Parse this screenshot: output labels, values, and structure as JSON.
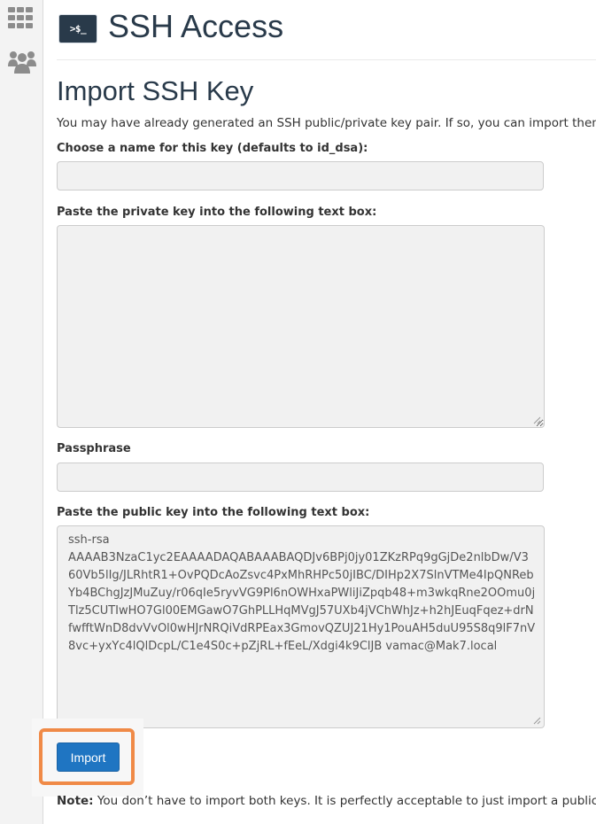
{
  "header": {
    "icon_text": ">$_",
    "title": "SSH Access"
  },
  "section": {
    "title": "Import SSH Key",
    "intro": "You may have already generated an SSH public/private key pair. If so, you can import them here."
  },
  "form": {
    "key_name_label": "Choose a name for this key (defaults to id_dsa):",
    "key_name_value": "",
    "private_key_label": "Paste the private key into the following text box:",
    "private_key_value": "",
    "passphrase_label": "Passphrase",
    "passphrase_value": "",
    "public_key_label": "Paste the public key into the following text box:",
    "public_key_value": "ssh-rsa\nAAAAB3NzaC1yc2EAAAADAQABAAABAQDJv6BPj0jy01ZKzRPq9gGjDe2nlbDw/V360Vb5lIg/JLRhtR1+OvPQDcAoZsvc4PxMhRHPc50jIBC/DIHp2X7SlnVTMe4IpQNRebYb4BChgJzJMuZuy/r06qIe5ryvVG9Pl6nOWHxaPWliJiZpqb48+m3wkqRne2OOmu0jTlz5CUTIwHO7Gl00EMGawO7GhPLLHqMVgJ57UXb4jVChWhJz+h2hJEuqFqez+drNfwfftWnD8dvVvOl0wHJrNRQiVdRPEax3GmovQZUJ21Hy1PouAH5duU95S8q9lF7nV8vc+yxYc4lQlDcpL/C1e4S0c+pZjRL+fEeL/Xdgi4k9ClJB vamac@Mak7.local",
    "import_button": "Import"
  },
  "note": {
    "label": "Note:",
    "text": " You don’t have to import both keys. It is perfectly acceptable to just import a public OR private key."
  },
  "colors": {
    "accent": "#1f75c2",
    "title": "#293a4a",
    "highlight": "#f08a47"
  }
}
